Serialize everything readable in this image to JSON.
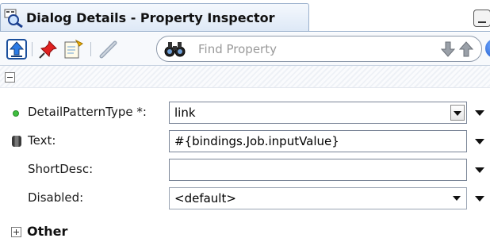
{
  "window": {
    "title": "Dialog Details - Property Inspector",
    "minimize_icon": "minimize-icon"
  },
  "toolbar": {
    "icons": [
      "upload-icon",
      "pin-icon",
      "edit-document-icon",
      "pencil-icon",
      "binoculars-icon",
      "arrow-down-icon",
      "arrow-up-icon",
      "help-icon"
    ],
    "search_placeholder": "Find Property",
    "help_label": "?"
  },
  "properties": [
    {
      "label": "DetailPatternType *:",
      "value": "link",
      "type": "combo",
      "marker": "required-dot-icon"
    },
    {
      "label": "Text:",
      "value": "#{bindings.Job.inputValue}",
      "type": "text",
      "marker": "database-icon"
    },
    {
      "label": "ShortDesc:",
      "value": "",
      "type": "text",
      "marker": ""
    },
    {
      "label": "Disabled:",
      "value": "<default>",
      "type": "combo",
      "marker": ""
    }
  ],
  "groups": [
    {
      "label": "Other",
      "expanded": false
    }
  ],
  "colors": {
    "accent": "#1d56c8",
    "tab_background": "#dde8f6",
    "required_dot": "#3fbf3f"
  }
}
